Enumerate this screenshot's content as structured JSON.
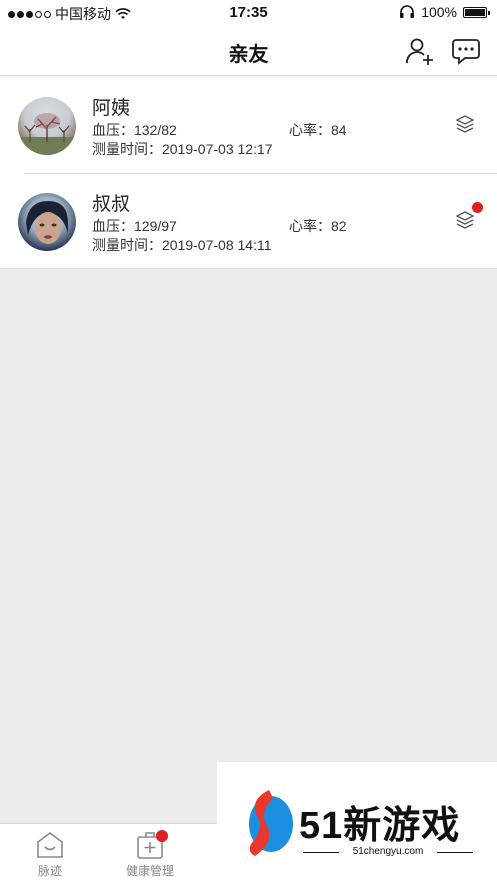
{
  "status_bar": {
    "carrier": "中国移动",
    "time": "17:35",
    "battery": "100%"
  },
  "nav": {
    "title": "亲友",
    "add_icon": "add-user-icon",
    "message_icon": "message-icon"
  },
  "contacts": [
    {
      "name": "阿姨",
      "bp_label": "血压：",
      "bp": "132/82",
      "hr_label": "心率：",
      "hr": "84",
      "time_label": "测量时间：",
      "time": "2019-07-03 12:17",
      "has_unread": false
    },
    {
      "name": "叔叔",
      "bp_label": "血压：",
      "bp": "129/97",
      "hr_label": "心率：",
      "hr": "82",
      "time_label": "测量时间：",
      "time": "2019-07-08 14:11",
      "has_unread": true
    }
  ],
  "tabs": [
    {
      "label": "脉迹",
      "icon": "home-icon"
    },
    {
      "label": "健康管理",
      "icon": "medical-kit-icon",
      "badge": true
    }
  ],
  "watermark": {
    "brand": "51新游戏",
    "url": "51chengyu.com"
  },
  "colors": {
    "badge": "#e02020",
    "background": "#ececec"
  }
}
